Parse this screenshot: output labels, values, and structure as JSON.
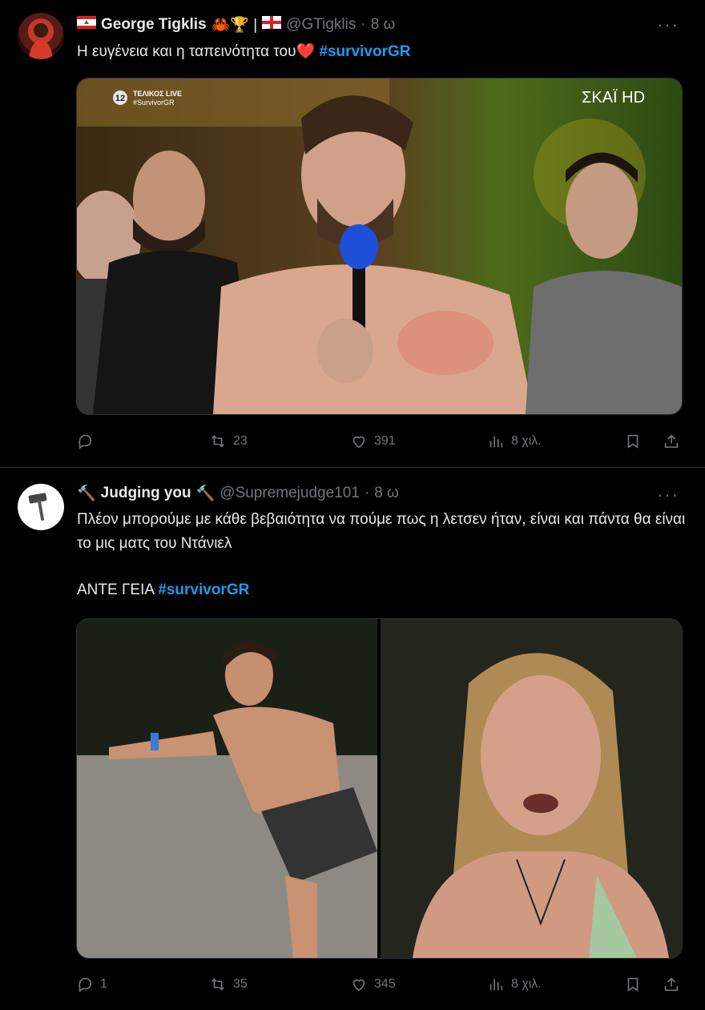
{
  "tweets": [
    {
      "display_name": "George Tigklis",
      "name_icons": "🦀🏆 |",
      "handle": "@GTigklis",
      "time": "8 ω",
      "text": "Η ευγένεια και η ταπεινότητα του❤️",
      "hashtag": "#survivorGR",
      "media_overlay": {
        "channel_badge": "12",
        "live_label": "ΤΕΛΙΚΟΣ LIVE",
        "live_tag": "#SurvivorGR",
        "broadcaster": "ΣΚΑΪ HD"
      },
      "stats": {
        "replies": "",
        "retweets": "23",
        "likes": "391",
        "views": "8 χιλ."
      }
    },
    {
      "display_name": "Judging you",
      "name_icon_left": "🔨",
      "name_icon_right": "🔨",
      "handle": "@Supremejudge101",
      "time": "8 ω",
      "text": "Πλέον μπορούμε με κάθε βεβαιότητα να πούμε πως η λετσεν ήταν, είναι και πάντα θα είναι το μις ματς του Ντάνιελ",
      "text2": "ΑΝΤΕ ΓΕΙΑ",
      "hashtag": "#survivorGR",
      "stats": {
        "replies": "1",
        "retweets": "35",
        "likes": "345",
        "views": "8 χιλ."
      }
    }
  ],
  "colors": {
    "background": "#000000",
    "text": "#e7e9ea",
    "muted": "#71767b",
    "link": "#1d9bf0",
    "divider": "#2f3336"
  },
  "icons": [
    "reply-icon",
    "retweet-icon",
    "like-icon",
    "views-icon",
    "bookmark-icon",
    "share-icon",
    "more-icon"
  ]
}
